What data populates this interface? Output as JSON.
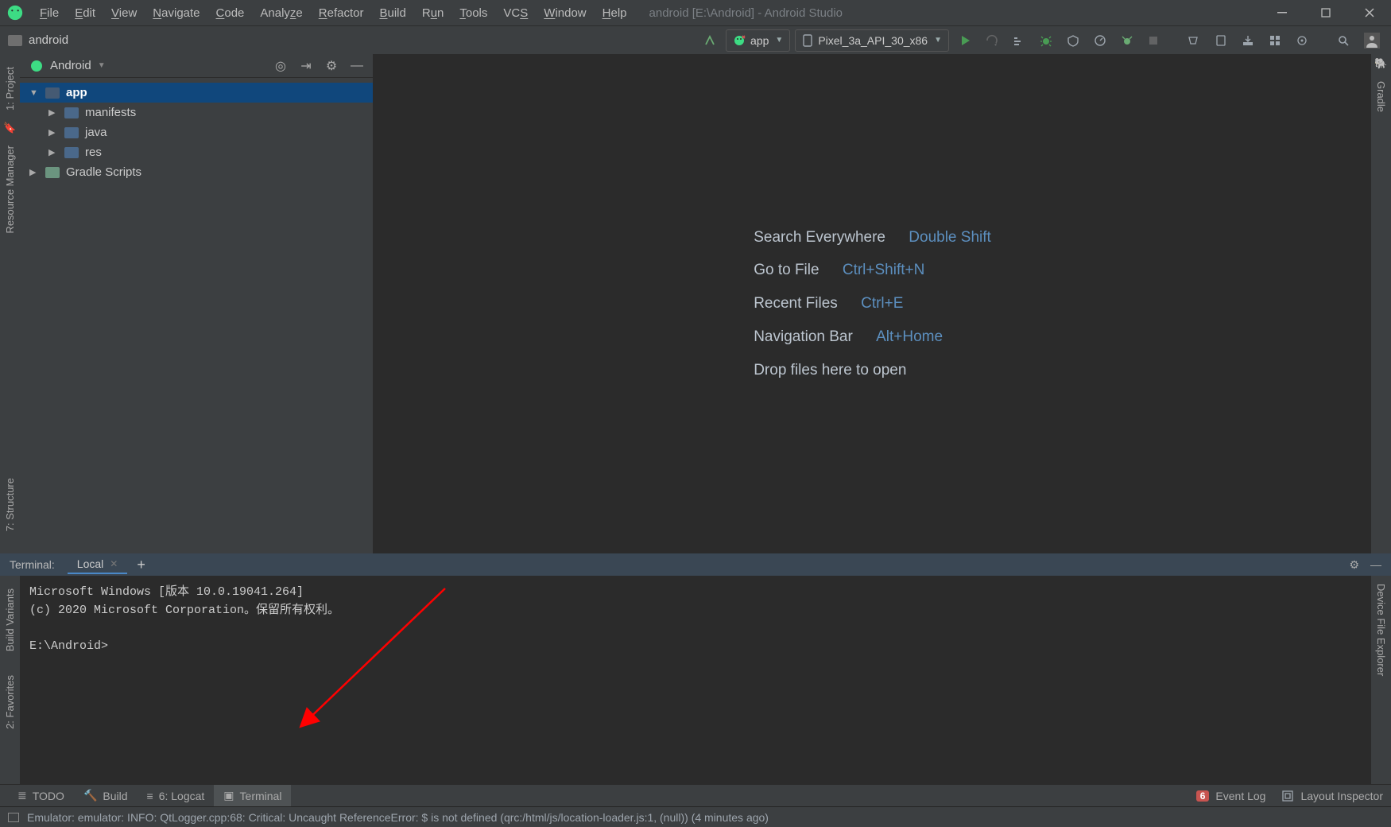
{
  "menu": {
    "items": [
      "File",
      "Edit",
      "View",
      "Navigate",
      "Code",
      "Analyze",
      "Refactor",
      "Build",
      "Run",
      "Tools",
      "VCS",
      "Window",
      "Help"
    ]
  },
  "title": "android [E:\\Android] - Android Studio",
  "breadcrumb": "android",
  "run_config": "app",
  "device": "Pixel_3a_API_30_x86",
  "project_view": {
    "mode": "Android",
    "root": "app",
    "nodes": [
      "manifests",
      "java",
      "res"
    ],
    "gradle": "Gradle Scripts"
  },
  "empty_editor": {
    "rows": [
      {
        "label": "Search Everywhere",
        "kb": "Double Shift"
      },
      {
        "label": "Go to File",
        "kb": "Ctrl+Shift+N"
      },
      {
        "label": "Recent Files",
        "kb": "Ctrl+E"
      },
      {
        "label": "Navigation Bar",
        "kb": "Alt+Home"
      }
    ],
    "drop": "Drop files here to open"
  },
  "left_strip": {
    "tabs": [
      "1: Project",
      "Resource Manager"
    ]
  },
  "right_strip": {
    "tabs": [
      "Gradle",
      "Device File Explorer"
    ]
  },
  "left_strip_bottom": {
    "tabs": [
      "7: Structure",
      "2: Favorites",
      "Build Variants"
    ]
  },
  "terminal": {
    "title": "Terminal:",
    "tab": "Local",
    "lines": [
      "Microsoft Windows [版本 10.0.19041.264]",
      "(c) 2020 Microsoft Corporation。保留所有权利。",
      "",
      "E:\\Android>"
    ]
  },
  "bottom_tabs": [
    {
      "label": "TODO"
    },
    {
      "label": "Build"
    },
    {
      "label": "6: Logcat"
    },
    {
      "label": "Terminal",
      "active": true
    }
  ],
  "bottom_right": {
    "event_count": "6",
    "event_log": "Event Log",
    "layout_inspector": "Layout Inspector"
  },
  "status_message": "Emulator: emulator: INFO: QtLogger.cpp:68: Critical: Uncaught ReferenceError: $ is not defined (qrc:/html/js/location-loader.js:1, (null)) (4 minutes ago)"
}
